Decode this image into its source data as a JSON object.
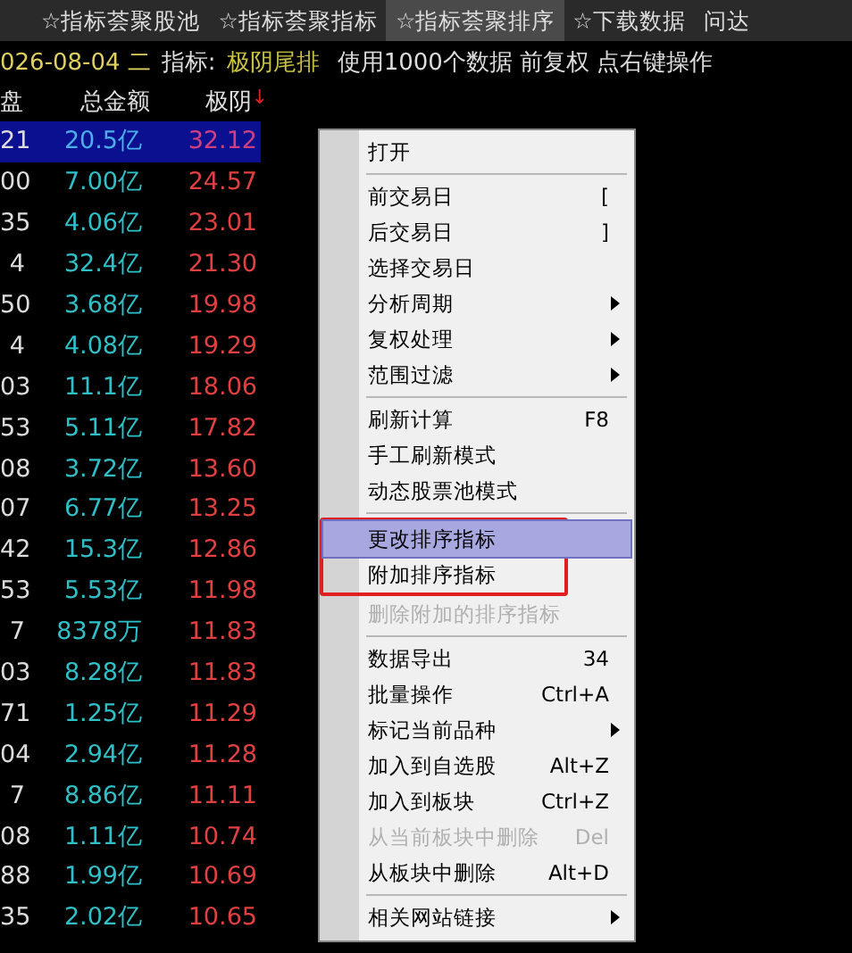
{
  "tabs": [
    {
      "label": "☆指标荟聚股池",
      "selected": false
    },
    {
      "label": "☆指标荟聚指标",
      "selected": false
    },
    {
      "label": "☆指标荟聚排序",
      "selected": true
    },
    {
      "label": "☆下载数据",
      "selected": false
    },
    {
      "label": "问达",
      "selected": false
    }
  ],
  "info_bar": {
    "date": "026-08-04 二",
    "indicator_label": "指标:",
    "indicator": "极阴尾排",
    "note": "使用1000个数据 前复权 点右键操作"
  },
  "table": {
    "columns": [
      {
        "label": "盘"
      },
      {
        "label": "总金额"
      },
      {
        "label": "极阴",
        "sort_mark": "↓"
      }
    ],
    "rows": [
      {
        "cells": [
          "21",
          "20.5亿",
          "32.12"
        ],
        "selected": true
      },
      {
        "cells": [
          "00",
          "7.00亿",
          "24.57"
        ],
        "selected": false
      },
      {
        "cells": [
          "35",
          "4.06亿",
          "23.01"
        ],
        "selected": false
      },
      {
        "cells": [
          "4",
          "32.4亿",
          "21.30"
        ],
        "selected": false
      },
      {
        "cells": [
          "50",
          "3.68亿",
          "19.98"
        ],
        "selected": false
      },
      {
        "cells": [
          "4",
          "4.08亿",
          "19.29"
        ],
        "selected": false
      },
      {
        "cells": [
          "03",
          "11.1亿",
          "18.06"
        ],
        "selected": false
      },
      {
        "cells": [
          "53",
          "5.11亿",
          "17.82"
        ],
        "selected": false
      },
      {
        "cells": [
          "08",
          "3.72亿",
          "13.60"
        ],
        "selected": false
      },
      {
        "cells": [
          "07",
          "6.77亿",
          "13.25"
        ],
        "selected": false
      },
      {
        "cells": [
          "42",
          "15.3亿",
          "12.86"
        ],
        "selected": false
      },
      {
        "cells": [
          "53",
          "5.53亿",
          "11.98"
        ],
        "selected": false
      },
      {
        "cells": [
          "7",
          "8378万",
          "11.83"
        ],
        "selected": false
      },
      {
        "cells": [
          "03",
          "8.28亿",
          "11.83"
        ],
        "selected": false
      },
      {
        "cells": [
          "71",
          "1.25亿",
          "11.29"
        ],
        "selected": false
      },
      {
        "cells": [
          "04",
          "2.94亿",
          "11.28"
        ],
        "selected": false
      },
      {
        "cells": [
          "7",
          "8.86亿",
          "11.11"
        ],
        "selected": false
      },
      {
        "cells": [
          "08",
          "1.11亿",
          "10.74"
        ],
        "selected": false
      },
      {
        "cells": [
          "88",
          "1.99亿",
          "10.69"
        ],
        "selected": false
      },
      {
        "cells": [
          "35",
          "2.02亿",
          "10.65"
        ],
        "selected": false
      }
    ]
  },
  "context_menu": {
    "items": [
      {
        "kind": "item",
        "label": "打开",
        "submenu": false,
        "disabled": false,
        "selected": false,
        "outlined": false
      },
      {
        "kind": "separator"
      },
      {
        "kind": "item",
        "label": "前交易日",
        "shortcut": "[",
        "submenu": false,
        "disabled": false,
        "selected": false,
        "outlined": false
      },
      {
        "kind": "item",
        "label": "后交易日",
        "shortcut": "]",
        "submenu": false,
        "disabled": false,
        "selected": false,
        "outlined": false
      },
      {
        "kind": "item",
        "label": "选择交易日",
        "submenu": false,
        "disabled": false,
        "selected": false,
        "outlined": false
      },
      {
        "kind": "item",
        "label": "分析周期",
        "submenu": true,
        "disabled": false,
        "selected": false,
        "outlined": false
      },
      {
        "kind": "item",
        "label": "复权处理",
        "submenu": true,
        "disabled": false,
        "selected": false,
        "outlined": false
      },
      {
        "kind": "item",
        "label": "范围过滤",
        "submenu": true,
        "disabled": false,
        "selected": false,
        "outlined": false
      },
      {
        "kind": "separator"
      },
      {
        "kind": "item",
        "label": "刷新计算",
        "shortcut": "F8",
        "submenu": false,
        "disabled": false,
        "selected": false,
        "outlined": false
      },
      {
        "kind": "item",
        "label": "手工刷新模式",
        "submenu": false,
        "disabled": false,
        "selected": false,
        "outlined": false
      },
      {
        "kind": "item",
        "label": "动态股票池模式",
        "submenu": false,
        "disabled": false,
        "selected": false,
        "outlined": false
      },
      {
        "kind": "separator"
      },
      {
        "kind": "item",
        "label": "更改排序指标",
        "submenu": false,
        "disabled": false,
        "selected": true,
        "outlined": true
      },
      {
        "kind": "item",
        "label": "附加排序指标",
        "submenu": false,
        "disabled": false,
        "selected": false,
        "outlined": true
      },
      {
        "kind": "item",
        "label": "删除附加的排序指标",
        "submenu": false,
        "disabled": true,
        "selected": false,
        "outlined": false
      },
      {
        "kind": "separator"
      },
      {
        "kind": "item",
        "label": "数据导出",
        "shortcut": "34",
        "submenu": false,
        "disabled": false,
        "selected": false,
        "outlined": false
      },
      {
        "kind": "item",
        "label": "批量操作",
        "shortcut": "Ctrl+A",
        "submenu": false,
        "disabled": false,
        "selected": false,
        "outlined": false
      },
      {
        "kind": "item",
        "label": "标记当前品种",
        "submenu": true,
        "disabled": false,
        "selected": false,
        "outlined": false
      },
      {
        "kind": "item",
        "label": "加入到自选股",
        "shortcut": "Alt+Z",
        "submenu": false,
        "disabled": false,
        "selected": false,
        "outlined": false
      },
      {
        "kind": "item",
        "label": "加入到板块",
        "shortcut": "Ctrl+Z",
        "submenu": false,
        "disabled": false,
        "selected": false,
        "outlined": false
      },
      {
        "kind": "item",
        "label": "从当前板块中删除",
        "shortcut": "Del",
        "submenu": false,
        "disabled": true,
        "selected": false,
        "outlined": false
      },
      {
        "kind": "item",
        "label": "从板块中删除",
        "shortcut": "Alt+D",
        "submenu": false,
        "disabled": false,
        "selected": false,
        "outlined": false
      },
      {
        "kind": "separator"
      },
      {
        "kind": "item",
        "label": "相关网站链接",
        "submenu": true,
        "disabled": false,
        "selected": false,
        "outlined": false
      }
    ]
  }
}
